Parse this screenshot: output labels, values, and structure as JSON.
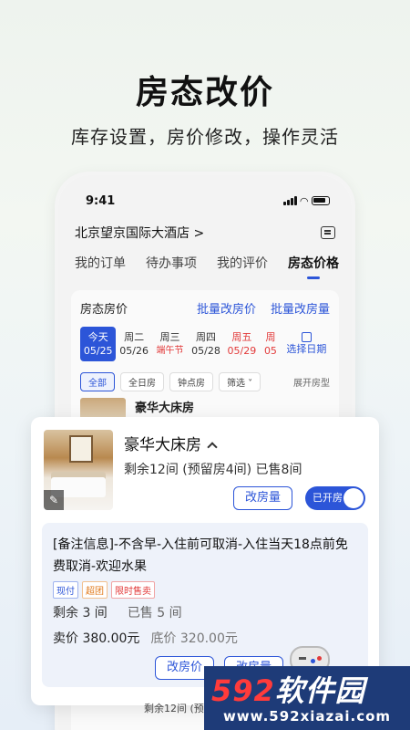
{
  "hero": {
    "title": "房态改价",
    "subtitle": "库存设置，房价修改，操作灵活"
  },
  "status_bar": {
    "time": "9:41"
  },
  "hotel": {
    "name": "北京望京国际大酒店 >"
  },
  "tabs": [
    {
      "label": "我的订单"
    },
    {
      "label": "待办事项"
    },
    {
      "label": "我的评价"
    },
    {
      "label": "房态价格"
    }
  ],
  "panel": {
    "title": "房态房价",
    "batch_price": "批量改房价",
    "batch_rooms": "批量改房量",
    "dates": [
      {
        "day": "今天",
        "date": "05/25"
      },
      {
        "day": "周二",
        "date": "05/26"
      },
      {
        "day": "周三",
        "date": "端午节"
      },
      {
        "day": "周四",
        "date": "05/28"
      },
      {
        "day": "周五",
        "date": "05/29"
      },
      {
        "day": "周",
        "date": "05"
      }
    ],
    "pick_date": "选择日期",
    "filters": [
      "全部",
      "全日房",
      "钟点房",
      "筛选"
    ],
    "expand": "展开房型",
    "peek_room": "豪华大床房"
  },
  "card": {
    "room_name": "豪华大床房",
    "stock": "剩余12间 (预留房4间) 已售8间",
    "change_rooms": "改房量",
    "toggle_label": "已开房",
    "note": "[备注信息]-不含早-入住前可取消-入住当天18点前免费取消-欢迎水果",
    "tags": [
      "现付",
      "超团",
      "限时售卖"
    ],
    "remain": "剩余 3 间",
    "sold": "已售 5 间",
    "sell_price": "卖价 380.00元",
    "floor_price": "底价 320.00元",
    "change_price": "改房价",
    "change_rooms2": "改房量"
  },
  "bottom_peek": {
    "text": "剩余12间 (预留"
  },
  "watermark": {
    "num": "592",
    "text": "软件园",
    "url": "www.592xiazai.com"
  },
  "colors": {
    "accent": "#2c55d8",
    "holiday": "#e23a3a"
  }
}
